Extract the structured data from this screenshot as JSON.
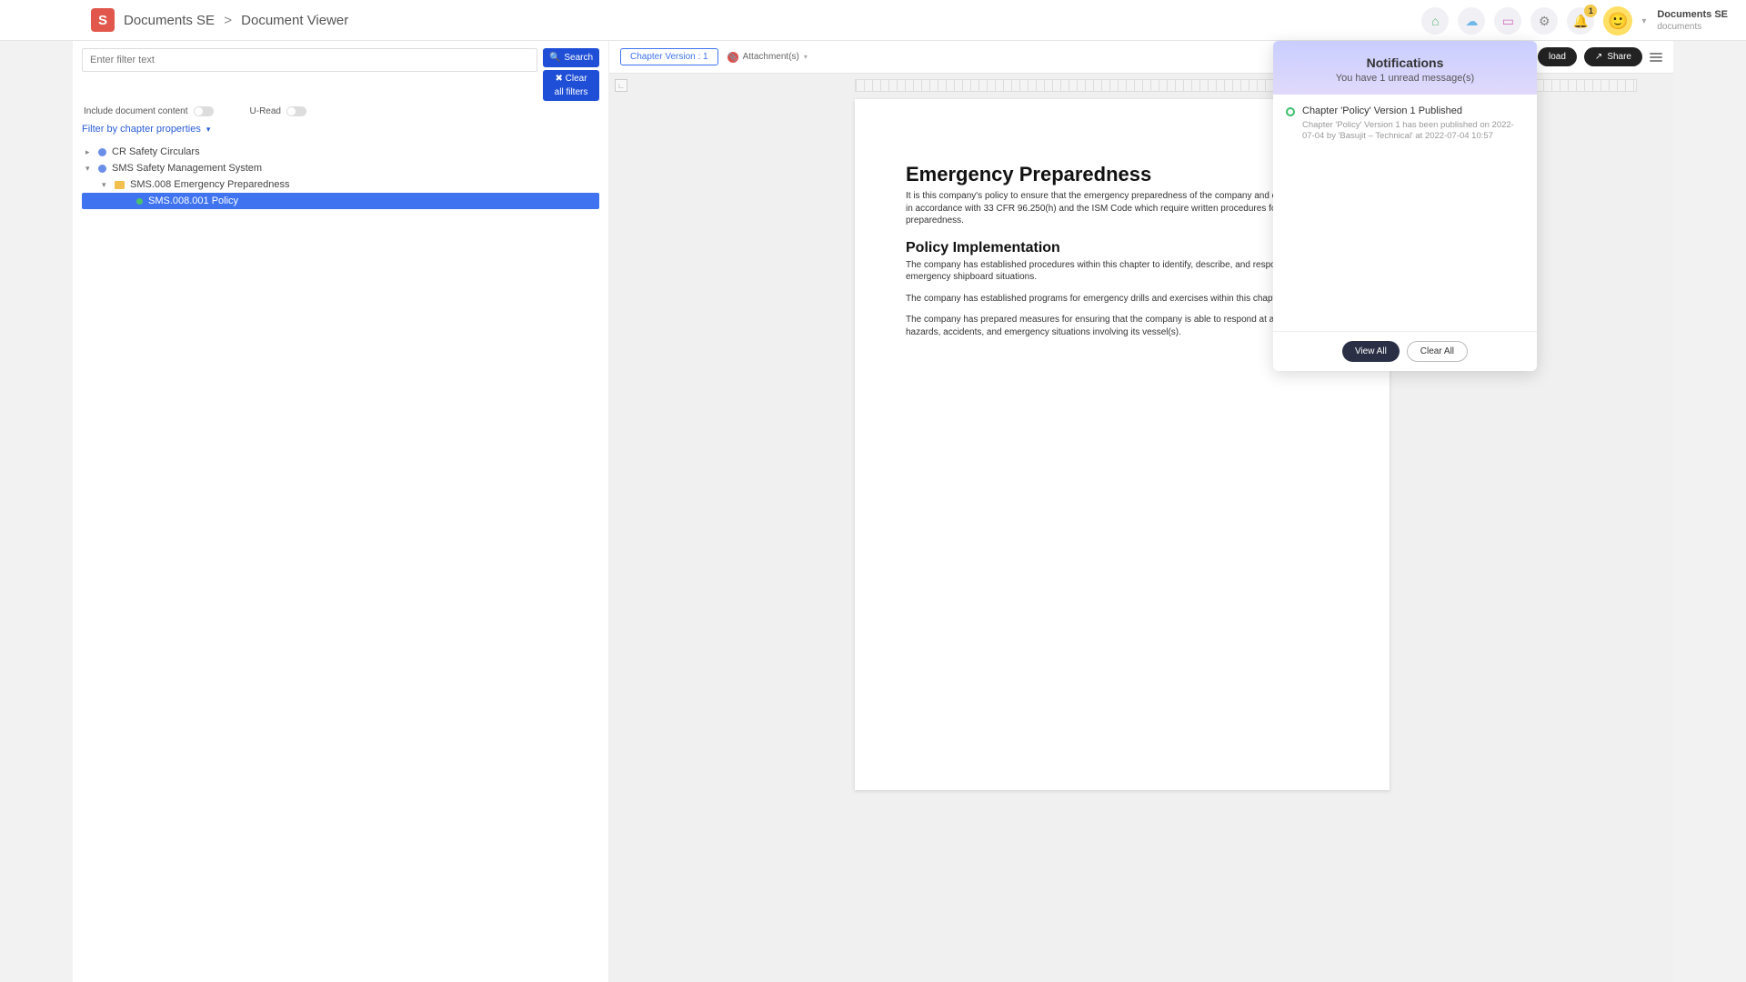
{
  "header": {
    "logo_letter": "S",
    "breadcrumb_root": "Documents SE",
    "breadcrumb_sep": ">",
    "breadcrumb_page": "Document Viewer",
    "bell_badge": "1",
    "user_title": "Documents SE",
    "user_sub": "documents"
  },
  "sidebar": {
    "filter_placeholder": "Enter filter text",
    "search_label": "Search",
    "clear_label_1": "Clear",
    "clear_label_2": "all filters",
    "toggle_content_label": "Include document content",
    "toggle_uread_label": "U-Read",
    "filter_props_label": "Filter by chapter properties",
    "tree": {
      "n1": "CR Safety Circulars",
      "n2": "SMS Safety Management System",
      "n3": "SMS.008 Emergency Preparedness",
      "n4": "SMS.008.001 Policy"
    }
  },
  "viewerbar": {
    "chapter_version": "Chapter Version : 1",
    "attachments": "Attachment(s)",
    "download": "load",
    "share": "Share"
  },
  "doc": {
    "h1": "Emergency Preparedness",
    "p1": "It is this company's policy to ensure that the emergency preparedness of the company and each vessel is in accordance with 33 CFR 96.250(h) and the ISM Code which require written procedures for emergency preparedness.",
    "h2": "Policy Implementation",
    "p2": "The company has established procedures within this chapter to identify, describe, and respond to possible emergency shipboard situations.",
    "p3": "The company has established programs for emergency drills and exercises within this chapter.",
    "p4": "The company has prepared measures for ensuring that the company is able to respond at any time to hazards, accidents, and emergency situations involving its vessel(s)."
  },
  "notif": {
    "title": "Notifications",
    "subtitle": "You have 1 unread message(s)",
    "item_title": "Chapter 'Policy' Version 1 Published",
    "item_desc": "Chapter 'Policy' Version 1 has been published on 2022-07-04 by 'Basujit – Technical' at 2022-07-04 10:57",
    "view_all": "View All",
    "clear_all": "Clear All"
  }
}
